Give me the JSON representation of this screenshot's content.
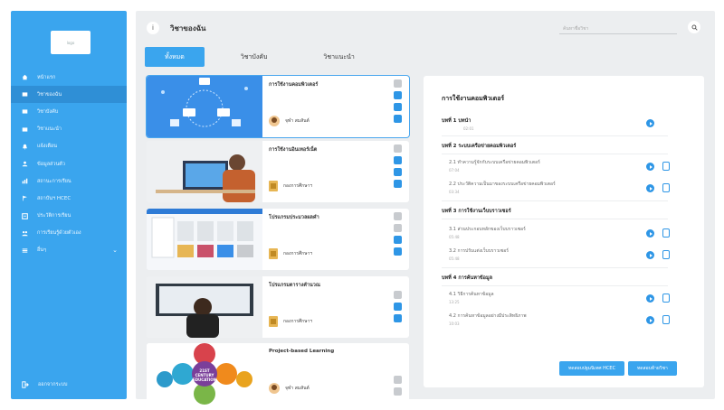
{
  "sidebar": {
    "logo_text": "logo",
    "items": [
      {
        "label": "หน้าแรก",
        "icon": "home-icon"
      },
      {
        "label": "วิชาของฉัน",
        "icon": "monitor-icon",
        "active": true
      },
      {
        "label": "วิชาบังคับ",
        "icon": "monitor-icon"
      },
      {
        "label": "วิชาแนะนำ",
        "icon": "monitor-icon"
      },
      {
        "label": "แจ้งเตือน",
        "icon": "bell-icon"
      },
      {
        "label": "ข้อมูลส่วนตัว",
        "icon": "user-icon"
      },
      {
        "label": "สถานะการเรียน",
        "icon": "chart-icon"
      },
      {
        "label": "สถาบันฯ HCEC",
        "icon": "flag-icon"
      },
      {
        "label": "ประวัติการเรียน",
        "icon": "history-icon"
      },
      {
        "label": "การเรียนรู้ด้วยตัวเอง",
        "icon": "people-icon"
      },
      {
        "label": "อื่นๆ",
        "icon": "menu-icon",
        "has_chevron": true
      }
    ],
    "logout_label": "ออกจากระบบ"
  },
  "header": {
    "title": "วิชาของฉัน",
    "search_placeholder": "ค้นหาชื่อวิชา"
  },
  "tabs": [
    {
      "label": "ทั้งหมด",
      "active": true
    },
    {
      "label": "วิชาบังคับ"
    },
    {
      "label": "วิชาแนะนำ"
    }
  ],
  "courses": [
    {
      "title": "การใช้งานคอมพิวเตอร์",
      "author": "จุฬา สมสันต์",
      "author_type": "person",
      "icons": [
        "gray",
        "blue",
        "blue",
        "blue"
      ],
      "selected": true
    },
    {
      "title": "การใช้งานอินเทอร์เน็ต",
      "author": "กองการศึกษาฯ",
      "author_type": "org",
      "icons": [
        "gray",
        "blue",
        "blue",
        "blue"
      ]
    },
    {
      "title": "โปรแกรมประมวลผลคำ",
      "author": "กองการศึกษาฯ",
      "author_type": "org",
      "icons": [
        "gray",
        "gray",
        "blue",
        "blue"
      ]
    },
    {
      "title": "โปรแกรมตารางคำนวณ",
      "author": "กองการศึกษาฯ",
      "author_type": "org",
      "icons": [
        "gray",
        "blue",
        "blue"
      ]
    },
    {
      "title": "Project-based Learning",
      "author": "จุฬา สมสันต์",
      "author_type": "person",
      "icons": [
        "gray",
        "gray"
      ],
      "thumb_text": "21ST CENTURY EDUCATION"
    }
  ],
  "panel": {
    "title": "การใช้งานคอมพิวเตอร์",
    "chapters": [
      {
        "title": "บทที่ 1 บทนำ",
        "duration": "02:01",
        "play": true
      },
      {
        "title": "บทที่ 2 ระบบเครือข่ายคอมพิวเตอร์",
        "lessons": [
          {
            "title": "2.1 ทำความรู้จักกับระบบเครือข่ายคอมพิวเตอร์",
            "duration": "07:04"
          },
          {
            "title": "2.2 ประวัติความเป็นมาของระบบเครือข่ายคอมพิวเตอร์",
            "duration": "03:34"
          }
        ]
      },
      {
        "title": "บทที่ 3 การใช้งานเว็บบราวเซอร์",
        "lessons": [
          {
            "title": "3.1 ส่วนประกอบหลักของเว็บบราวเซอร์",
            "duration": "05:48"
          },
          {
            "title": "3.2 การปรับแต่งเว็บบราวเซอร์",
            "duration": "05:48"
          }
        ]
      },
      {
        "title": "บทที่ 4 การค้นหาข้อมูล",
        "lessons": [
          {
            "title": "4.1 วิธีการค้นหาข้อมูล",
            "duration": "13:25"
          },
          {
            "title": "4.2 การค้นหาข้อมูลอย่างมีประสิทธิภาพ",
            "duration": "10:03"
          }
        ]
      }
    ],
    "button_left": "ทดสอบปฐมนิเทศ HCEC",
    "button_right": "ทดสอบท้ายวิชา"
  },
  "colors": {
    "accent": "#3aa5ee",
    "icon_blue": "#2e96e6"
  }
}
